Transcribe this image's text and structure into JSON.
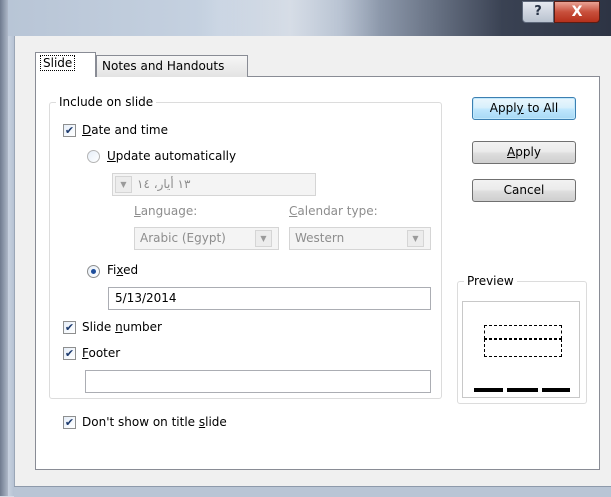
{
  "window": {
    "help_glyph": "?",
    "close_glyph": "X"
  },
  "tabs": [
    {
      "label": "Slide",
      "active": true
    },
    {
      "label": "Notes and Handouts",
      "active": false
    }
  ],
  "include_group": {
    "label": "Include on slide",
    "date_time": {
      "checked": true,
      "pre": "",
      "key": "D",
      "post": "ate and time"
    },
    "update_auto": {
      "selected": false,
      "pre": "",
      "key": "U",
      "post": "pdate automatically"
    },
    "date_combo_value": "١٣ أيار، ١٤",
    "language_label": {
      "pre": "",
      "key": "L",
      "post": "anguage:"
    },
    "language_value": "Arabic (Egypt)",
    "calendar_label": {
      "pre": "",
      "key": "C",
      "post": "alendar type:"
    },
    "calendar_value": "Western",
    "fixed": {
      "selected": true,
      "pre": "Fi",
      "key": "x",
      "post": "ed"
    },
    "fixed_value": "5/13/2014",
    "slide_number": {
      "checked": true,
      "pre": "Slide ",
      "key": "n",
      "post": "umber"
    },
    "footer": {
      "checked": true,
      "pre": "",
      "key": "F",
      "post": "ooter"
    },
    "footer_value": ""
  },
  "dont_show_title": {
    "checked": true,
    "pre": "Don't show on title ",
    "key": "s",
    "post": "lide"
  },
  "buttons": {
    "apply_all": {
      "pre": "Appl",
      "key": "y",
      "post": " to All"
    },
    "apply": {
      "pre": "",
      "key": "A",
      "post": "pply"
    },
    "cancel": "Cancel"
  },
  "preview_label": "Preview",
  "icons": {
    "check": "✔",
    "combo_arrow": "▼"
  }
}
